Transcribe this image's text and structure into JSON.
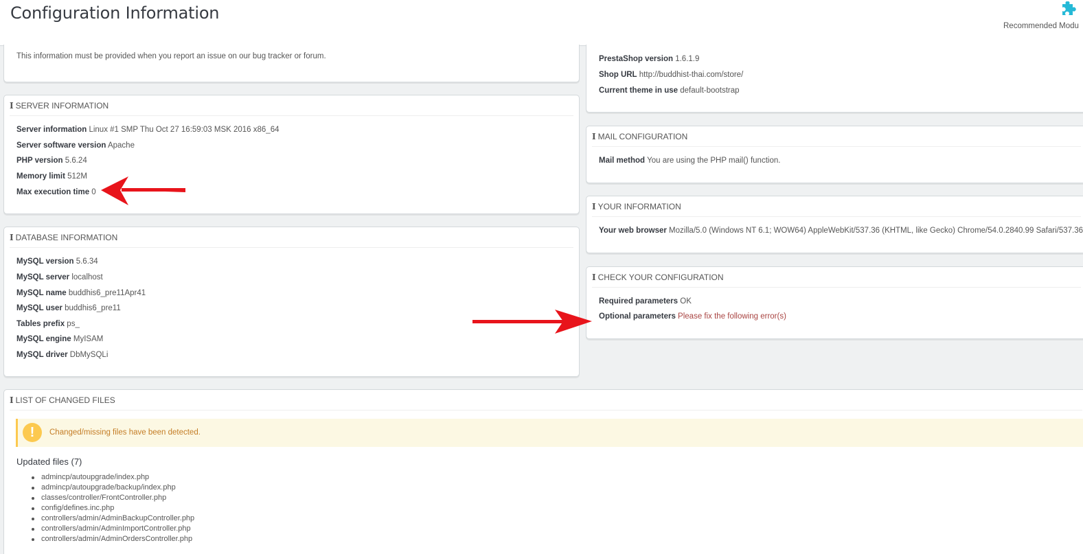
{
  "header": {
    "title": "Configuration Information",
    "recommended_modules_label": "Recommended Modu",
    "recommended_modules_icon": "puzzle-piece-icon"
  },
  "intro_panel": {
    "text": "This information must be provided when you report an issue on our bug tracker or forum."
  },
  "shop_panel": {
    "rows": [
      {
        "label": "PrestaShop version",
        "value": "1.6.1.9"
      },
      {
        "label": "Shop URL",
        "value": "http://buddhist-thai.com/store/"
      },
      {
        "label": "Current theme in use",
        "value": "default-bootstrap"
      }
    ]
  },
  "server_panel": {
    "title": "SERVER INFORMATION",
    "rows": [
      {
        "label": "Server information",
        "value": "Linux #1 SMP Thu Oct 27 16:59:03 MSK 2016 x86_64"
      },
      {
        "label": "Server software version",
        "value": "Apache"
      },
      {
        "label": "PHP version",
        "value": "5.6.24"
      },
      {
        "label": "Memory limit",
        "value": "512M"
      },
      {
        "label": "Max execution time",
        "value": "0"
      }
    ]
  },
  "database_panel": {
    "title": "DATABASE INFORMATION",
    "rows": [
      {
        "label": "MySQL version",
        "value": "5.6.34"
      },
      {
        "label": "MySQL server",
        "value": "localhost"
      },
      {
        "label": "MySQL name",
        "value": "buddhis6_pre11Apr41"
      },
      {
        "label": "MySQL user",
        "value": "buddhis6_pre11"
      },
      {
        "label": "Tables prefix",
        "value": "ps_"
      },
      {
        "label": "MySQL engine",
        "value": "MyISAM"
      },
      {
        "label": "MySQL driver",
        "value": "DbMySQLi"
      }
    ]
  },
  "mail_panel": {
    "title": "MAIL CONFIGURATION",
    "rows": [
      {
        "label": "Mail method",
        "value": "You are using the PHP mail() function."
      }
    ]
  },
  "your_info_panel": {
    "title": "YOUR INFORMATION",
    "rows": [
      {
        "label": "Your web browser",
        "value": "Mozilla/5.0 (Windows NT 6.1; WOW64) AppleWebKit/537.36 (KHTML, like Gecko) Chrome/54.0.2840.99 Safari/537.36"
      }
    ]
  },
  "check_panel": {
    "title": "CHECK YOUR CONFIGURATION",
    "rows": [
      {
        "label": "Required parameters",
        "value": "OK"
      },
      {
        "label": "Optional parameters",
        "value": "Please fix the following error(s)"
      }
    ]
  },
  "files_panel": {
    "title": "LIST OF CHANGED FILES",
    "warning": "Changed/missing files have been detected.",
    "updated_title": "Updated files (7)",
    "files": [
      "admincp/autoupgrade/index.php",
      "admincp/autoupgrade/backup/index.php",
      "classes/controller/FrontController.php",
      "config/defines.inc.php",
      "controllers/admin/AdminBackupController.php",
      "controllers/admin/AdminImportController.php",
      "controllers/admin/AdminOrdersController.php"
    ]
  },
  "colors": {
    "annotation_arrow": "#e8141b",
    "error_text": "#a94442",
    "warning_bg": "#fcf8e3",
    "warning_accent": "#fcc94f",
    "brand_icon": "#25b9d7"
  }
}
